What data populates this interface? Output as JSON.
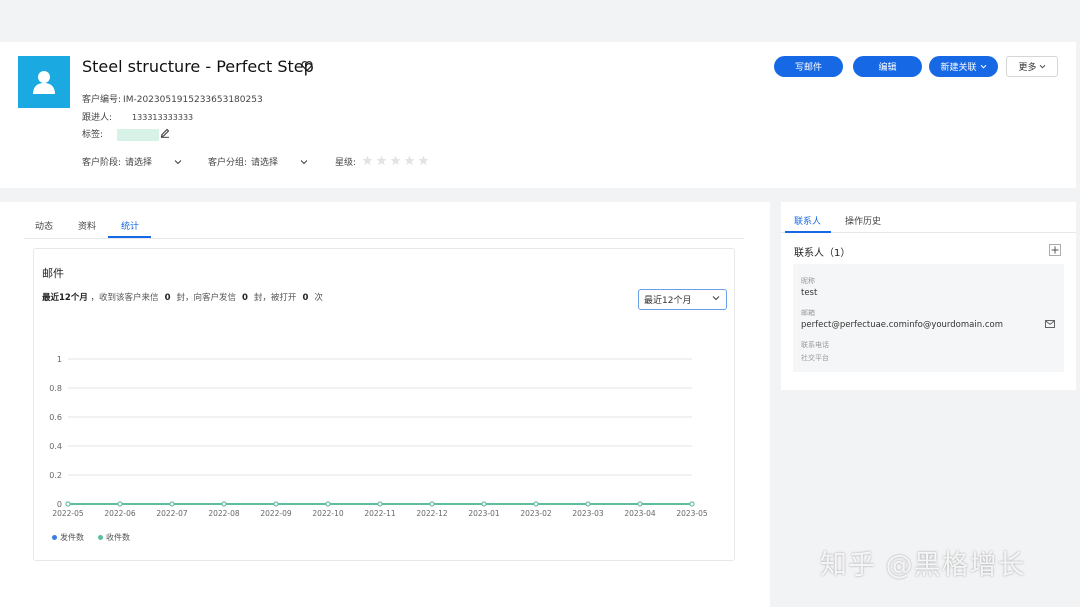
{
  "customer": {
    "name": "Steel structure - Perfect Step",
    "id_label": "客户编号:",
    "id_value": "IM-2023051915233653180253",
    "follower_label": "跟进人:",
    "follower_value": "133313333333",
    "tag_label": "标签:",
    "stage_label": "客户阶段:",
    "stage_value": "请选择",
    "group_label": "客户分组:",
    "group_value": "请选择",
    "rating_label": "星级:",
    "rating_stars": 5
  },
  "actions": {
    "write_mail": "写邮件",
    "edit": "编辑",
    "new_link": "新建关联",
    "more": "更多"
  },
  "tabs": [
    "动态",
    "资料",
    "统计"
  ],
  "stats": {
    "title": "邮件",
    "summary": {
      "period": "最近12个月",
      "t1": "，收到该客户来信",
      "received": "0",
      "t2": "封，向客户发信",
      "sent": "0",
      "t3": "封，被打开",
      "opened": "0",
      "t4": "次"
    },
    "range_value": "最近12个月",
    "legend": [
      "发件数",
      "收件数"
    ]
  },
  "chart_data": {
    "type": "line",
    "x": [
      "2022-05",
      "2022-06",
      "2022-07",
      "2022-08",
      "2022-09",
      "2022-10",
      "2022-11",
      "2022-12",
      "2023-01",
      "2023-02",
      "2023-03",
      "2023-04",
      "2023-05"
    ],
    "series": [
      {
        "name": "发件数",
        "values": [
          0,
          0,
          0,
          0,
          0,
          0,
          0,
          0,
          0,
          0,
          0,
          0,
          0
        ],
        "color": "#3b7be8"
      },
      {
        "name": "收件数",
        "values": [
          0,
          0,
          0,
          0,
          0,
          0,
          0,
          0,
          0,
          0,
          0,
          0,
          0
        ],
        "color": "#5cbf98"
      }
    ],
    "yticks": [
      "1",
      "0.8",
      "0.6",
      "0.4",
      "0.2",
      "0"
    ],
    "ylim": [
      0,
      1
    ],
    "grid": true,
    "legend_position": "bottom-left"
  },
  "side": {
    "tabs": [
      "联系人",
      "操作历史"
    ],
    "contacts_title": "联系人（1）",
    "contact": {
      "nickname_label": "昵称",
      "nickname": "test",
      "email_label": "邮箱",
      "email": "perfect@perfectuae.cominfo@yourdomain.com",
      "phone_label": "联系电话",
      "social_label": "社交平台"
    }
  },
  "watermark": "知乎 @黑格增长",
  "colors": {
    "accent": "#1768e4",
    "avatar": "#1aa9e1",
    "tag": "#d7f2e6"
  }
}
